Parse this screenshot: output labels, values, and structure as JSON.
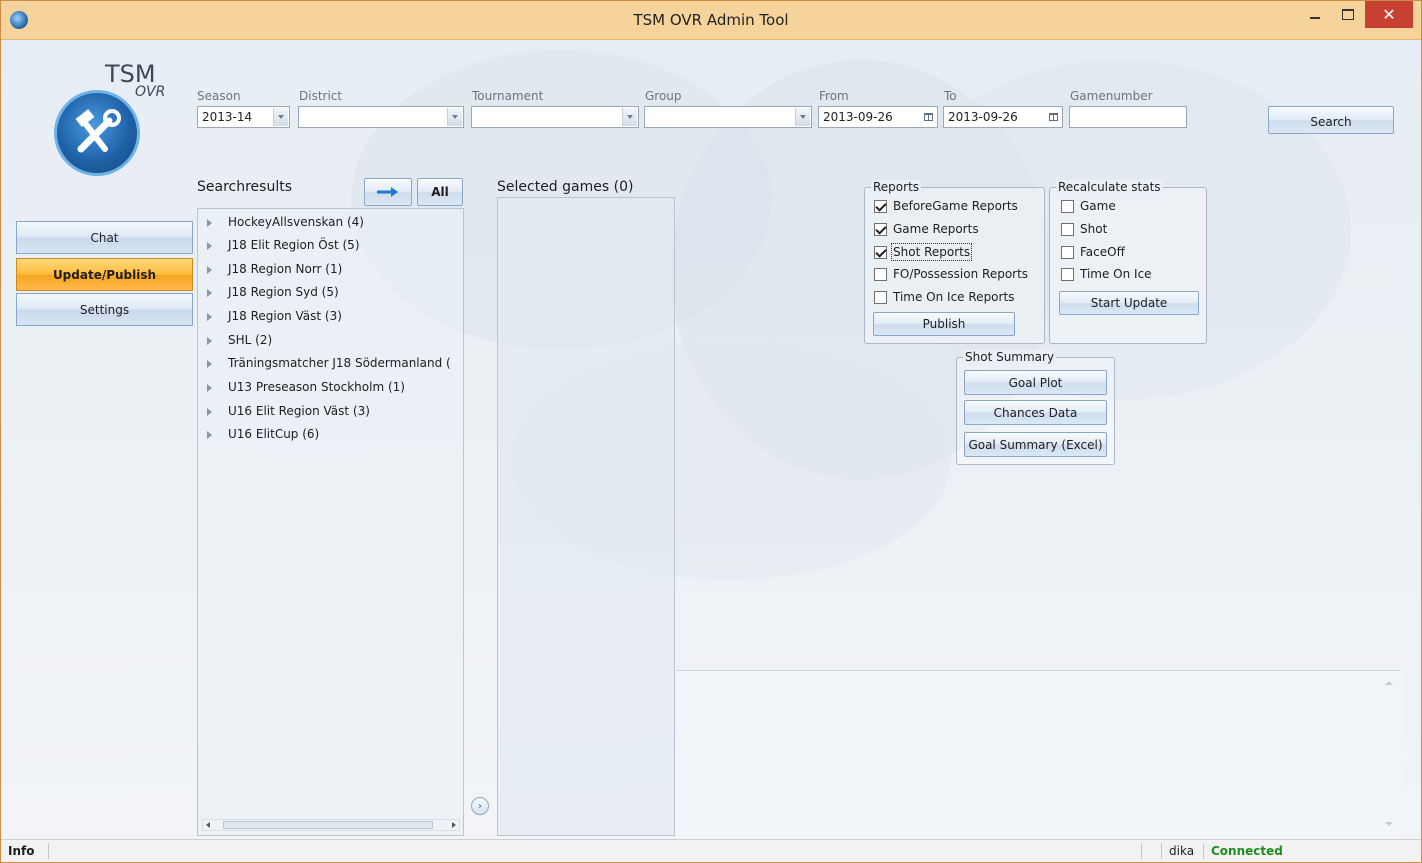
{
  "window": {
    "title": "TSM OVR Admin Tool",
    "minimize_icon": "minimize-icon",
    "maximize_icon": "maximize-icon",
    "close_label": "✕"
  },
  "logo": {
    "line1": "TSM",
    "line2": "OVR"
  },
  "filters": {
    "season_label": "Season",
    "season_value": "2013-14",
    "district_label": "District",
    "district_value": "",
    "tournament_label": "Tournament",
    "tournament_value": "",
    "group_label": "Group",
    "group_value": "",
    "from_label": "From",
    "from_value": "2013-09-26",
    "to_label": "To",
    "to_value": "2013-09-26",
    "gamenumber_label": "Gamenumber",
    "gamenumber_value": "",
    "search_label": "Search"
  },
  "nav": {
    "items": [
      {
        "label": "Chat"
      },
      {
        "label": "Update/Publish",
        "active": true
      },
      {
        "label": "Settings"
      }
    ]
  },
  "searchresults": {
    "label": "Searchresults",
    "all_label": "All",
    "items": [
      "HockeyAllsvenskan (4)",
      "J18 Elit Region Öst (5)",
      "J18 Region Norr (1)",
      "J18 Region Syd (5)",
      "J18 Region Väst (3)",
      "SHL (2)",
      "Träningsmatcher J18 Södermanland (",
      "U13 Preseason Stockholm (1)",
      "U16 Elit Region Väst (3)",
      "U16 ElitCup (6)"
    ]
  },
  "selected": {
    "label": "Selected games (0)"
  },
  "reports": {
    "title": "Reports",
    "items": [
      {
        "label": "BeforeGame Reports",
        "checked": true
      },
      {
        "label": "Game Reports",
        "checked": true
      },
      {
        "label": "Shot Reports",
        "checked": true
      },
      {
        "label": "FO/Possession Reports",
        "checked": false
      },
      {
        "label": "Time On Ice Reports",
        "checked": false
      }
    ],
    "publish_label": "Publish"
  },
  "recalc": {
    "title": "Recalculate stats",
    "items": [
      {
        "label": "Game",
        "checked": false
      },
      {
        "label": "Shot",
        "checked": false
      },
      {
        "label": "FaceOff",
        "checked": false
      },
      {
        "label": "Time On Ice",
        "checked": false
      }
    ],
    "start_label": "Start Update"
  },
  "shot_summary": {
    "title": "Shot Summary",
    "goal_plot_label": "Goal Plot",
    "chances_label": "Chances Data",
    "goal_summary_label": "Goal Summary (Excel)"
  },
  "status": {
    "info": "Info",
    "user": "dika",
    "connection": "Connected"
  },
  "colors": {
    "titlebar": "#f6d39b",
    "close": "#c84032",
    "active_nav": "#ffbd3d",
    "connected": "#1e8c1e"
  }
}
